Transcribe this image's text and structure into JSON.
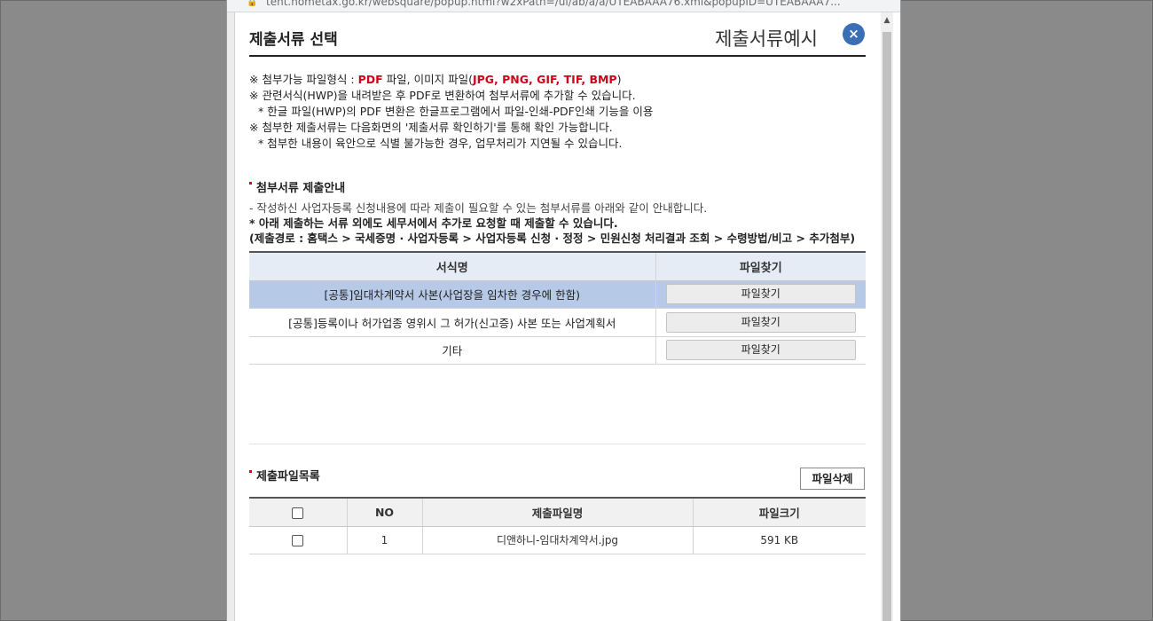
{
  "browser": {
    "url": "tent.hometax.go.kr/websquare/popup.html?w2xPath=/ui/ab/a/a/UTEABAAA76.xml&popupID=UTEABAAA7..."
  },
  "header": {
    "title": "제출서류 선택",
    "example_title": "제출서류예시",
    "close_label": "×"
  },
  "notices": {
    "line1_prefix": "※ 첨부가능 파일형식 : ",
    "line1_pdf": "PDF",
    "line1_mid": " 파일, 이미지 파일(",
    "line1_formats": "JPG, PNG, GIF, TIF, BMP",
    "line1_suffix": ")",
    "line2": "※ 관련서식(HWP)을 내려받은 후 PDF로 변환하여 첨부서류에 추가할 수 있습니다.",
    "line3": "* 한글 파일(HWP)의 PDF 변환은 한글프로그램에서 파일-인쇄-PDF인쇄 기능을 이용",
    "line4": "※ 첨부한 제출서류는 다음화면의 '제출서류 확인하기'를 통해 확인 가능합니다.",
    "line5": "* 첨부한 내용이 육안으로 식별 불가능한 경우, 업무처리가 지연될 수 있습니다."
  },
  "guide": {
    "title": "첨부서류 제출안내",
    "line1": "- 작성하신 사업자등록 신청내용에 따라 제출이 필요할 수 있는 첨부서류를 아래와 같이 안내합니다.",
    "line2": "* 아래 제출하는 서류 외에도 세무서에서 추가로 요청할 때 제출할 수 있습니다.",
    "line3": "(제출경로 : 홈택스 > 국세증명 · 사업자등록 > 사업자등록 신청 · 정정 > 민원신청 처리결과 조회 > 수령방법/비고 > 추가첨부)"
  },
  "doc_table": {
    "headers": [
      "서식명",
      "파일찾기"
    ],
    "rows": [
      {
        "name": "[공통]임대차계약서 사본(사업장을 임차한 경우에 한함)",
        "button": "파일찾기"
      },
      {
        "name": "[공통]등록이나 허가업종 영위시 그 허가(신고증) 사본 또는 사업계획서",
        "button": "파일찾기"
      },
      {
        "name": "기타",
        "button": "파일찾기"
      }
    ]
  },
  "file_list": {
    "title": "제출파일목록",
    "delete_label": "파일삭제",
    "headers": [
      "NO",
      "제출파일명",
      "파일크기"
    ],
    "rows": [
      {
        "no": "1",
        "filename": "디앤하니-임대차계약서.jpg",
        "size": "591 KB"
      }
    ]
  },
  "colors": {
    "accent_red": "#d0021b",
    "close_blue": "#3a6fb5",
    "selected_row": "#b6c9e6",
    "header_row": "#e6ecf6"
  }
}
